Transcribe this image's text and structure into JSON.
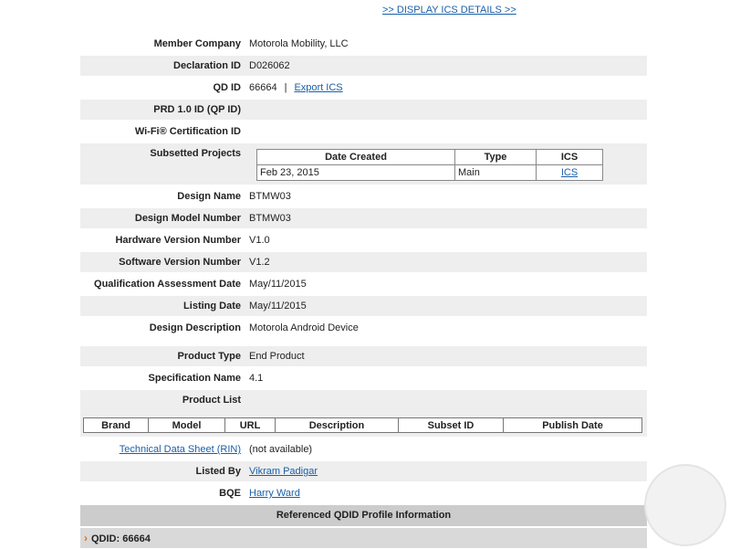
{
  "display_ics_link": ">> DISPLAY ICS DETAILS >>",
  "fields": {
    "member_company": {
      "label": "Member Company",
      "value": "Motorola Mobility, LLC"
    },
    "declaration_id": {
      "label": "Declaration ID",
      "value": "D026062"
    },
    "qd_id": {
      "label": "QD ID",
      "value": "66664",
      "separator": "|",
      "link": "Export ICS"
    },
    "prd_id": {
      "label": "PRD 1.0 ID (QP ID)",
      "value": ""
    },
    "wifi_cert": {
      "label": "Wi-Fi® Certification ID",
      "value": ""
    },
    "subsetted_projects": {
      "label": "Subsetted Projects"
    },
    "design_name": {
      "label": "Design Name",
      "value": "BTMW03"
    },
    "design_model_number": {
      "label": "Design Model Number",
      "value": "BTMW03"
    },
    "hardware_version": {
      "label": "Hardware Version Number",
      "value": "V1.0"
    },
    "software_version": {
      "label": "Software Version Number",
      "value": "V1.2"
    },
    "qa_date": {
      "label": "Qualification Assessment Date",
      "value": "May/11/2015"
    },
    "listing_date": {
      "label": "Listing Date",
      "value": "May/11/2015"
    },
    "design_description": {
      "label": "Design Description",
      "value": "Motorola Android Device"
    },
    "product_type": {
      "label": "Product Type",
      "value": "End Product"
    },
    "spec_name": {
      "label": "Specification Name",
      "value": "4.1"
    },
    "product_list": {
      "label": "Product List",
      "value": ""
    },
    "tech_sheet": {
      "label": "Technical Data Sheet (RIN)",
      "value": "(not available)"
    },
    "listed_by": {
      "label": "Listed By",
      "value": "Vikram Padigar"
    },
    "bqe": {
      "label": "BQE",
      "value": "Harry Ward"
    }
  },
  "subset_table": {
    "headers": {
      "date": "Date Created",
      "type": "Type",
      "ics": "ICS"
    },
    "rows": [
      {
        "date": "Feb 23, 2015",
        "type": "Main",
        "ics": "ICS"
      }
    ]
  },
  "product_table": {
    "headers": {
      "brand": "Brand",
      "model": "Model",
      "url": "URL",
      "description": "Description",
      "subset": "Subset ID",
      "publish": "Publish Date"
    }
  },
  "referenced_title": "Referenced QDID Profile Information",
  "qdid_row": "QDID: 66664",
  "colors": {
    "link": "#1a5fa8",
    "shade": "#eeeeee",
    "header_bar": "#cccccc",
    "chevron": "#e07020"
  }
}
